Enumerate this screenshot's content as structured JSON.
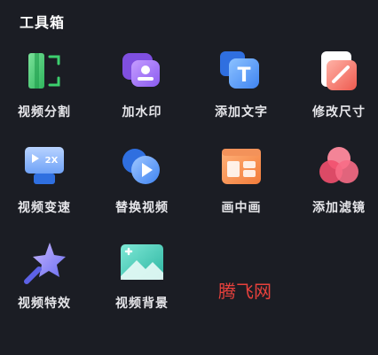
{
  "section": {
    "title": "工具箱"
  },
  "tools": [
    {
      "label": "视频分割",
      "icon": "split-video-icon"
    },
    {
      "label": "加水印",
      "icon": "watermark-icon"
    },
    {
      "label": "添加文字",
      "icon": "add-text-icon"
    },
    {
      "label": "修改尺寸",
      "icon": "resize-icon"
    },
    {
      "label": "视频变速",
      "icon": "speed-icon"
    },
    {
      "label": "替换视频",
      "icon": "replace-video-icon"
    },
    {
      "label": "画中画",
      "icon": "picture-in-picture-icon"
    },
    {
      "label": "添加滤镜",
      "icon": "filter-icon"
    },
    {
      "label": "视频特效",
      "icon": "effects-star-icon"
    },
    {
      "label": "视频背景",
      "icon": "background-image-icon"
    }
  ],
  "watermark": {
    "text": "腾飞网"
  },
  "icon_texts": {
    "speed": "2X",
    "text_glyph": "T"
  },
  "colors": {
    "background": "#1b1d24",
    "green": "#3ccf6e",
    "purple": "#9b6cf0",
    "blue": "#4a8ef5",
    "coral": "#f3685e",
    "orange": "#f58a4b",
    "pink": "#f2506e",
    "teal": "#3cc9b5"
  }
}
